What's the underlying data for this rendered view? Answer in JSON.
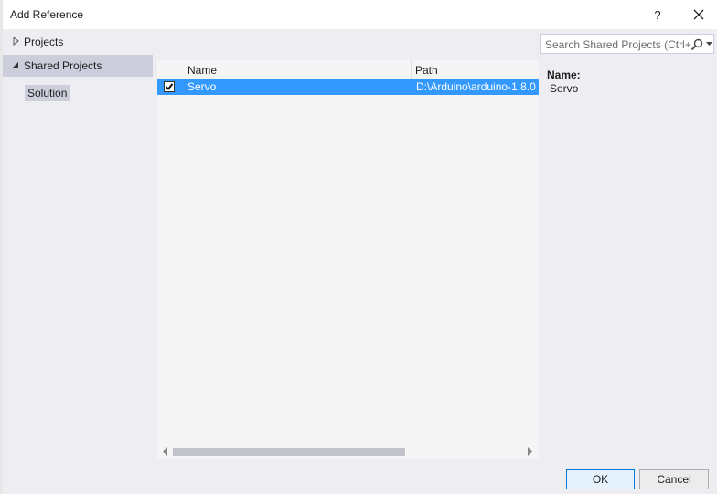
{
  "window": {
    "title": "Add Reference",
    "help_label": "?"
  },
  "nav": {
    "items": [
      {
        "label": "Projects",
        "expanded": false
      },
      {
        "label": "Shared Projects",
        "expanded": true,
        "selected": true
      }
    ],
    "sub_items": [
      {
        "label": "Solution"
      }
    ]
  },
  "search": {
    "placeholder": "Search Shared Projects (Ctrl+"
  },
  "table": {
    "columns": [
      "Name",
      "Path"
    ],
    "rows": [
      {
        "checked": true,
        "name": "Servo",
        "path": "D:\\Arduino\\arduino-1.8.0"
      }
    ]
  },
  "detail": {
    "name_label": "Name:",
    "name_value": "Servo"
  },
  "footer": {
    "ok_label": "OK",
    "cancel_label": "Cancel"
  },
  "colors": {
    "accent": "#3399ff",
    "nav_selected": "#cccedb",
    "panel_bg": "#eeeef2",
    "list_bg": "#f5f5f5"
  }
}
